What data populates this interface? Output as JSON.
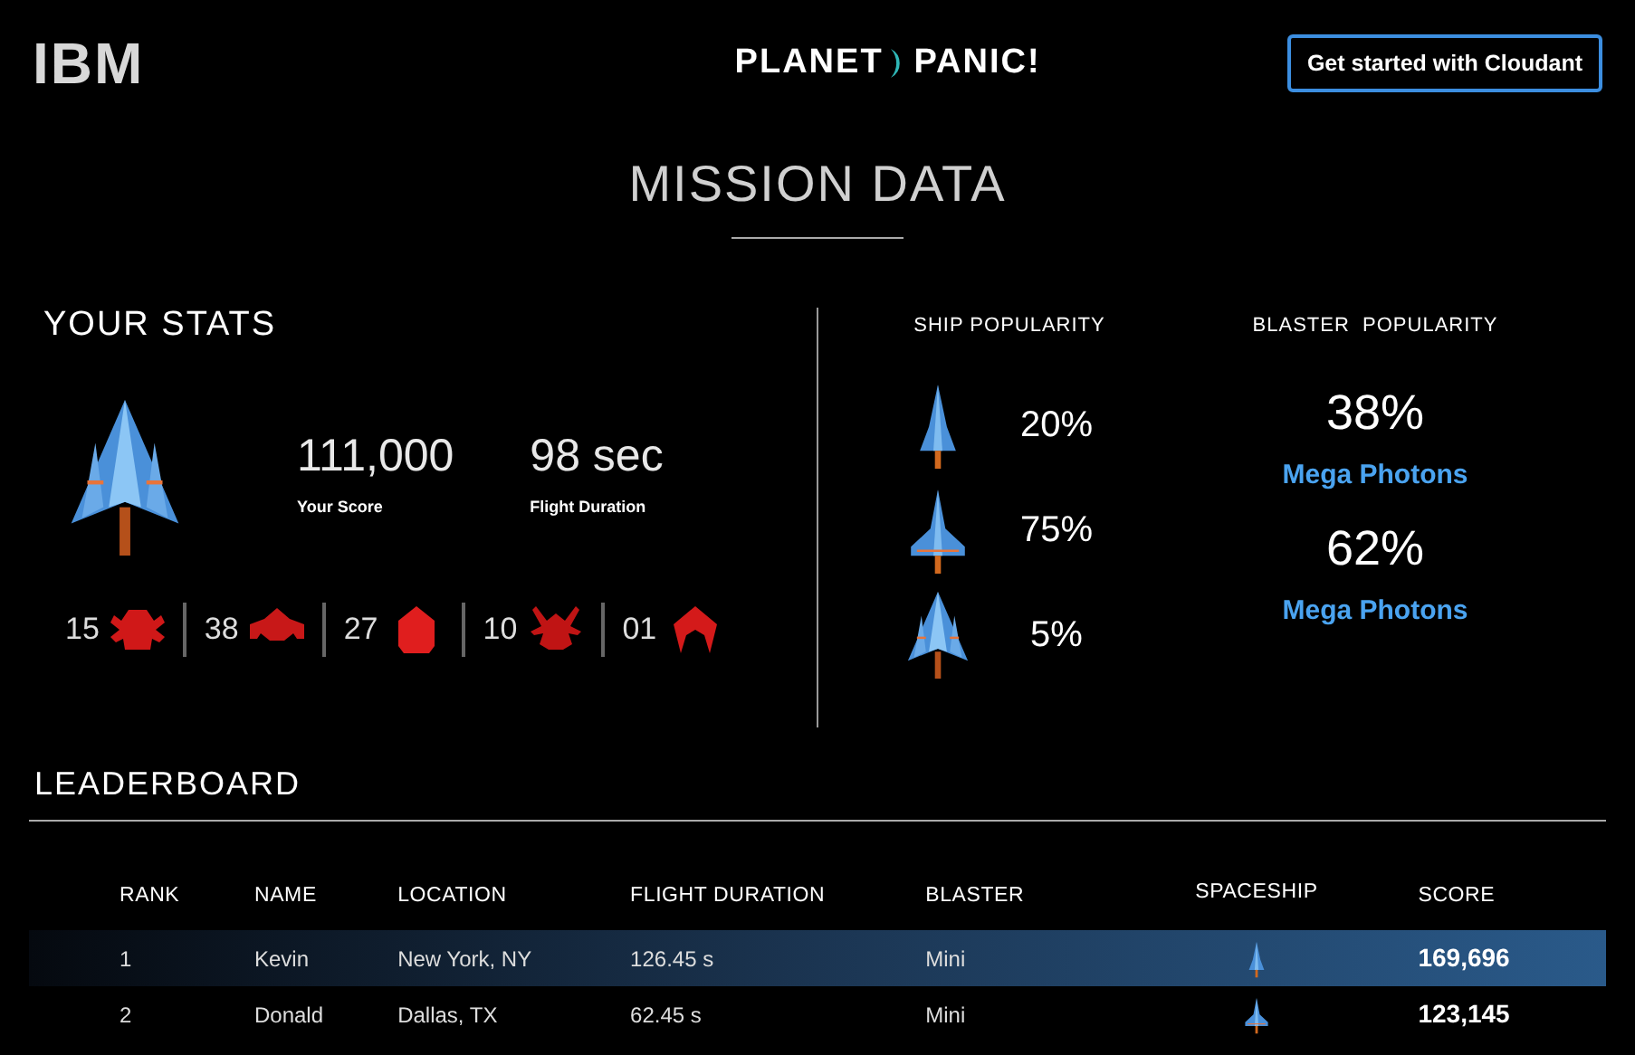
{
  "header": {
    "logo": "IBM",
    "title_left": "PLANET",
    "title_right": "PANIC!",
    "cta": "Get started with Cloudant"
  },
  "page_title": "MISSION DATA",
  "your_stats": {
    "title": "YOUR STATS",
    "ship": {
      "kind": "delta"
    },
    "score": "111,000",
    "score_label": "Your Score",
    "duration": "98 sec",
    "duration_label": "Flight Duration",
    "kills": [
      {
        "count": "15",
        "kind": "bug"
      },
      {
        "count": "38",
        "kind": "crab"
      },
      {
        "count": "27",
        "kind": "pod"
      },
      {
        "count": "10",
        "kind": "spider"
      },
      {
        "count": "01",
        "kind": "claw"
      }
    ]
  },
  "ship_popularity": {
    "title": "SHIP POPULARITY",
    "items": [
      {
        "kind": "slim",
        "percent": "20%"
      },
      {
        "kind": "winged",
        "percent": "75%"
      },
      {
        "kind": "delta",
        "percent": "5%"
      }
    ]
  },
  "blaster_popularity": {
    "title": "BLASTER  POPULARITY",
    "items": [
      {
        "percent": "38%",
        "name": "Mega Photons"
      },
      {
        "percent": "62%",
        "name": "Mega Photons"
      }
    ]
  },
  "leaderboard": {
    "title": "LEADERBOARD",
    "columns": [
      "RANK",
      "NAME",
      "LOCATION",
      "FLIGHT DURATION",
      "BLASTER",
      "SPACESHIP",
      "SCORE"
    ],
    "rows": [
      {
        "rank": "1",
        "name": "Kevin",
        "location": "New York, NY",
        "duration": "126.45 s",
        "blaster": "Mini",
        "ship": {
          "kind": "slim"
        },
        "score": "169,696",
        "selected": true
      },
      {
        "rank": "2",
        "name": "Donald",
        "location": "Dallas, TX",
        "duration": "62.45 s",
        "blaster": "Mini",
        "ship": {
          "kind": "winged"
        },
        "score": "123,145",
        "selected": false
      }
    ]
  }
}
